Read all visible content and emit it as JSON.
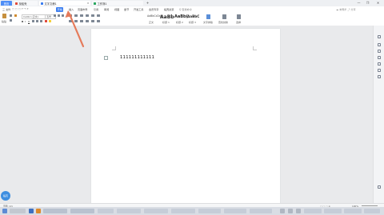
{
  "titlebar": {
    "home_label": "首页",
    "tabs": [
      {
        "label": "找稻壳",
        "icon_color": "#e0493a"
      },
      {
        "label": "文字文稿1",
        "icon_color": "#3c7ef0"
      },
      {
        "label": "工作簿1",
        "icon_color": "#2aa860"
      }
    ],
    "window_controls": {
      "restore": "❐",
      "minimize": "—",
      "close": "✕"
    }
  },
  "menubar": {
    "items": [
      "三 文件",
      "开始",
      "插入",
      "页面布局",
      "引用",
      "审阅",
      "视图",
      "章节",
      "开发工具",
      "会员专享",
      "稻壳资源",
      "Q 查找命令"
    ],
    "active_index": 1
  },
  "ribbon": {
    "font_name": "Calibri (正文)",
    "font_size": "五号",
    "style_samples": [
      "AaBbCcDd",
      "AaBb",
      "AaBb(",
      "AaBbC"
    ],
    "labels": [
      "正文",
      "标题 1",
      "标题 2",
      "标题 3",
      "文字排版",
      "查找替换",
      "选择"
    ]
  },
  "document": {
    "text": "111111111111"
  },
  "statusbar": {
    "page_info": "页面: 1/1",
    "zoom": "100%"
  },
  "avatar": {
    "label": "稻壳"
  },
  "colors": {
    "accent": "#3c7ef0",
    "arrow": "#e57a5a"
  }
}
